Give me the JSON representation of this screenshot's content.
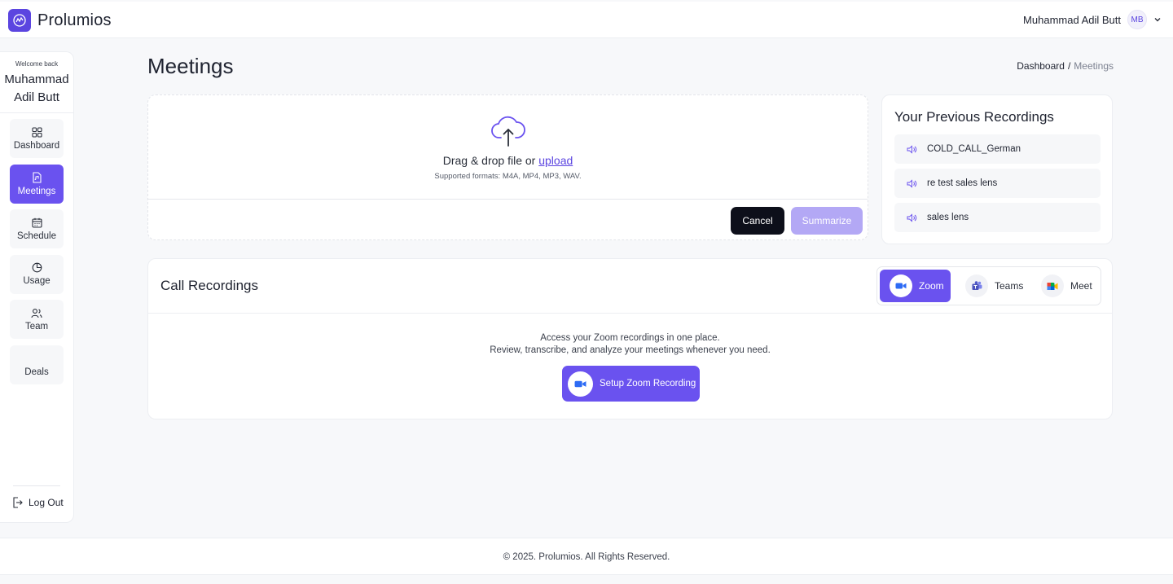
{
  "header": {
    "brand": "Prolumios",
    "user_name": "Muhammad Adil Butt",
    "avatar_initials": "MB"
  },
  "sidebar": {
    "welcome": "Welcome back",
    "name_line1": "Muhammad",
    "name_line2": "Adil Butt",
    "items": [
      {
        "label": "Dashboard",
        "icon": "grid-icon"
      },
      {
        "label": "Meetings",
        "icon": "file-audio-icon"
      },
      {
        "label": "Schedule",
        "icon": "calendar-icon"
      },
      {
        "label": "Usage",
        "icon": "pie-chart-icon"
      },
      {
        "label": "Team",
        "icon": "users-icon"
      },
      {
        "label": "Deals",
        "icon": ""
      }
    ],
    "logout": "Log Out"
  },
  "page": {
    "title": "Meetings",
    "breadcrumb_home": "Dashboard",
    "breadcrumb_sep": "/",
    "breadcrumb_current": "Meetings"
  },
  "upload": {
    "text": "Drag & drop file or",
    "link": "upload",
    "formats": "Supported formats: M4A, MP4, MP3, WAV.",
    "cancel": "Cancel",
    "summarize": "Summarize"
  },
  "previous": {
    "title": "Your Previous Recordings",
    "items": [
      "COLD_CALL_German",
      "re test sales lens",
      "sales lens"
    ]
  },
  "calls": {
    "title": "Call Recordings",
    "tabs": [
      {
        "label": "Zoom",
        "active": true
      },
      {
        "label": "Teams",
        "active": false
      },
      {
        "label": "Meet",
        "active": false
      }
    ],
    "desc_line1": "Access your Zoom recordings in one place.",
    "desc_line2": "Review, transcribe, and analyze your meetings whenever you need.",
    "setup_button": "Setup Zoom Recording"
  },
  "footer": {
    "text": "© 2025. Prolumios. All Rights Reserved."
  },
  "colors": {
    "accent": "#6a52ef",
    "accent_light": "#b3a8f5",
    "dark": "#0d0f1a"
  }
}
